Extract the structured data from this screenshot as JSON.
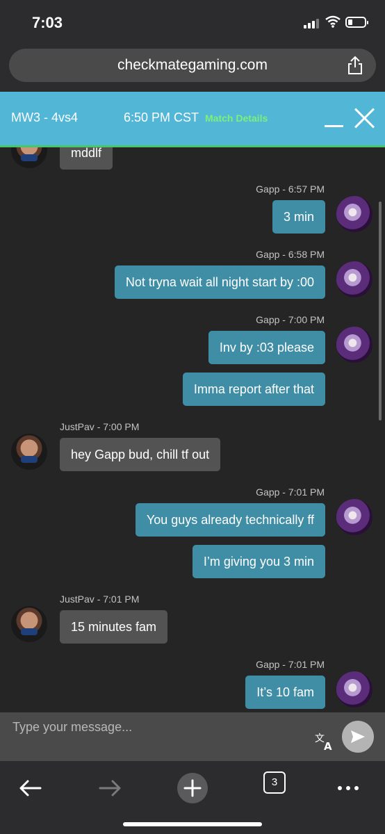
{
  "status_bar": {
    "time": "7:03"
  },
  "browser": {
    "url": "checkmategaming.com",
    "tabs_count": "3"
  },
  "header": {
    "title": "MW3 - 4vs4",
    "time": "6:50 PM CST",
    "details_link": "Match Details"
  },
  "messages": [
    {
      "side": "theirs",
      "meta": "",
      "text": "mddlf"
    },
    {
      "side": "mine",
      "meta": "Gapp - 6:57 PM",
      "text": "3 min"
    },
    {
      "side": "mine",
      "meta": "Gapp - 6:58 PM",
      "text": "Not tryna wait all night start by :00"
    },
    {
      "side": "mine",
      "meta": "Gapp - 7:00 PM",
      "text": "Inv by :03 please"
    },
    {
      "side": "mine",
      "meta": "",
      "text": "Imma report after that"
    },
    {
      "side": "theirs",
      "meta": "JustPav - 7:00 PM",
      "text": "hey Gapp bud, chill tf out"
    },
    {
      "side": "mine",
      "meta": "Gapp - 7:01 PM",
      "text": "You guys already technically ff"
    },
    {
      "side": "mine",
      "meta": "",
      "text": "I’m giving you 3 min"
    },
    {
      "side": "theirs",
      "meta": "JustPav - 7:01 PM",
      "text": "15 minutes fam"
    },
    {
      "side": "mine",
      "meta": "Gapp - 7:01 PM",
      "text": "It’s 10 fam"
    }
  ],
  "composer": {
    "placeholder": "Type your message..."
  },
  "colors": {
    "accent": "#52b6d7",
    "my_bubble": "#3f8ea5",
    "their_bubble": "#535353",
    "link": "#7ef07a"
  }
}
